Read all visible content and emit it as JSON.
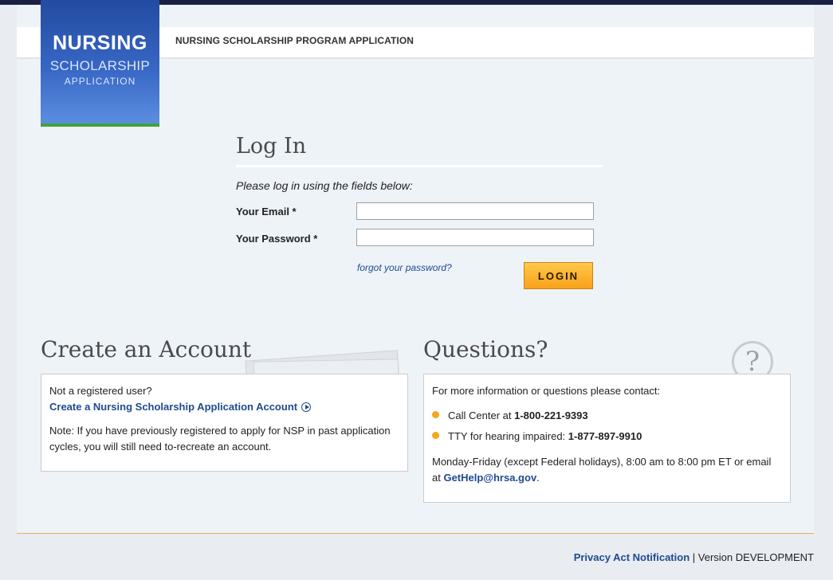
{
  "header": {
    "logo": {
      "line1": "NURSING",
      "line2": "SCHOLARSHIP",
      "line3": "APPLICATION"
    },
    "title": "NURSING SCHOLARSHIP PROGRAM APPLICATION"
  },
  "login": {
    "heading": "Log In",
    "instructions": "Please log in using the fields below:",
    "email_label": "Your Email *",
    "email_value": "",
    "password_label": "Your Password *",
    "password_value": "",
    "forgot_link": "forgot your password?",
    "login_button": "LOGIN"
  },
  "create_account": {
    "heading": "Create an Account",
    "not_registered": "Not a registered user?",
    "link": "Create a Nursing Scholarship Application Account",
    "note_line1": "Note: If you have previously registered to apply for NSP in past application",
    "note_line2": "cycles, you will still need to-recreate an account."
  },
  "questions": {
    "heading": "Questions?",
    "intro": "For more information or questions please contact:",
    "call_center_label": "Call Center at",
    "call_center_number": "1-800-221-9393",
    "tty_label": "TTY for hearing impaired:",
    "tty_number": "1-877-897-9910",
    "hours_line1": "Monday-Friday (except Federal holidays), 8:00 am to 8:00 pm ET or email",
    "hours_line2_prefix": "at",
    "email": "GetHelp@hrsa.gov",
    "hours_line2_suffix": "."
  },
  "footer": {
    "privacy_link": "Privacy Act Notification",
    "separator": "|",
    "version": "Version DEVELOPMENT"
  },
  "colors": {
    "accent": "#1f4a8f",
    "button": "#f8a11a",
    "bullet": "#f4a71c",
    "logo_green": "#41a33a",
    "topbar": "#1b1f45"
  },
  "icons": {
    "play": "play-circle-icon",
    "question": "question-mark-icon",
    "bullet": "bullet-dot-icon"
  }
}
